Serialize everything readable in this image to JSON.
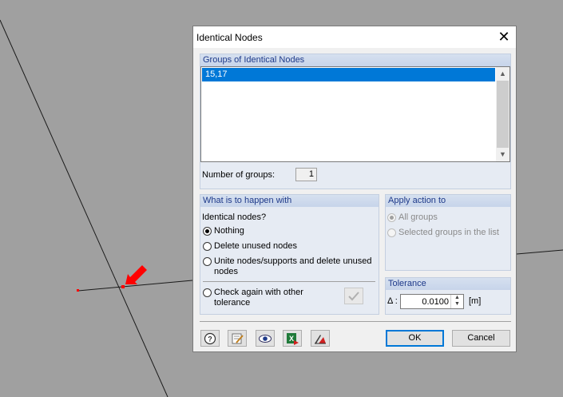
{
  "dialog": {
    "title": "Identical Nodes",
    "close_glyph": "✕"
  },
  "groups_section": {
    "header": "Groups of Identical Nodes",
    "items": [
      "15,17"
    ],
    "selected_index": 0,
    "number_of_groups_label": "Number of groups:",
    "number_of_groups_value": "1"
  },
  "what_section": {
    "header": "What is to happen with",
    "subheading": "Identical nodes?",
    "options": [
      {
        "label": "Nothing",
        "checked": true
      },
      {
        "label": "Delete unused nodes",
        "checked": false
      },
      {
        "label": "Unite nodes/supports and delete unused nodes",
        "checked": false
      },
      {
        "label": "Check again with other tolerance",
        "checked": false
      }
    ],
    "apply_button_icon": "checkmark-icon"
  },
  "apply_section": {
    "header": "Apply action to",
    "options": [
      {
        "label": "All groups",
        "checked": true,
        "disabled": true
      },
      {
        "label": "Selected groups in the list",
        "checked": false,
        "disabled": true
      }
    ]
  },
  "tolerance_section": {
    "header": "Tolerance",
    "symbol_label": "Δ :",
    "value": "0.0100",
    "unit": "[m]"
  },
  "footer": {
    "icon_buttons": [
      "help-icon",
      "edit-notes-icon",
      "view-eye-icon",
      "excel-export-icon",
      "units-icon"
    ],
    "ok_label": "OK",
    "cancel_label": "Cancel"
  },
  "colors": {
    "selection": "#0078d7",
    "group_header_text": "#1e3a8a",
    "node_marker": "#ff0000"
  }
}
